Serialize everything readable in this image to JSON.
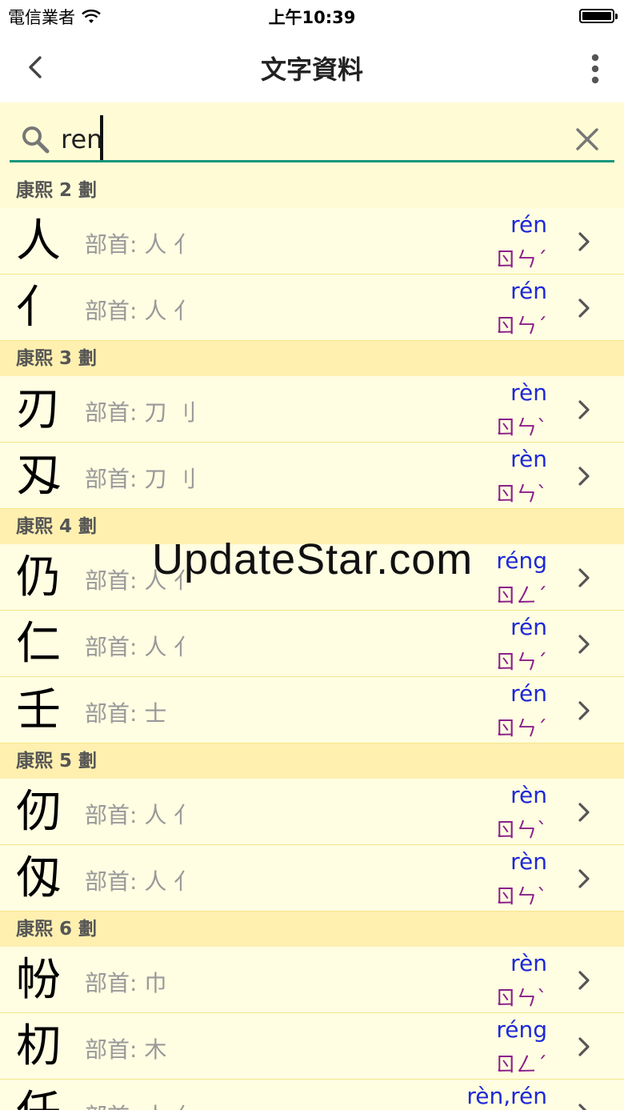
{
  "status_bar": {
    "carrier": "電信業者",
    "time": "上午10:39"
  },
  "nav": {
    "title": "文字資料"
  },
  "search": {
    "value": "ren"
  },
  "groups": [
    {
      "header": "康熙 2 劃",
      "rows": [
        {
          "char": "人",
          "radical": "部首: 人 亻",
          "pinyin": "rén",
          "zhuyin": "ㄖㄣˊ"
        },
        {
          "char": "亻",
          "radical": "部首: 人 亻",
          "pinyin": "rén",
          "zhuyin": "ㄖㄣˊ"
        }
      ]
    },
    {
      "header": "康熙 3 劃",
      "rows": [
        {
          "char": "刃",
          "radical": "部首: 刀 刂",
          "pinyin": "rèn",
          "zhuyin": "ㄖㄣˋ"
        },
        {
          "char": "刄",
          "radical": "部首: 刀 刂",
          "pinyin": "rèn",
          "zhuyin": "ㄖㄣˋ"
        }
      ]
    },
    {
      "header": "康熙 4 劃",
      "rows": [
        {
          "char": "仍",
          "radical": "部首: 人 亻",
          "pinyin": "réng",
          "zhuyin": "ㄖㄥˊ"
        },
        {
          "char": "仁",
          "radical": "部首: 人 亻",
          "pinyin": "rén",
          "zhuyin": "ㄖㄣˊ"
        },
        {
          "char": "壬",
          "radical": "部首: 士",
          "pinyin": "rén",
          "zhuyin": "ㄖㄣˊ"
        }
      ]
    },
    {
      "header": "康熙 5 劃",
      "rows": [
        {
          "char": "仞",
          "radical": "部首: 人 亻",
          "pinyin": "rèn",
          "zhuyin": "ㄖㄣˋ"
        },
        {
          "char": "仭",
          "radical": "部首: 人 亻",
          "pinyin": "rèn",
          "zhuyin": "ㄖㄣˋ"
        }
      ]
    },
    {
      "header": "康熙 6 劃",
      "rows": [
        {
          "char": "帉",
          "radical": "部首: 巾",
          "pinyin": "rèn",
          "zhuyin": "ㄖㄣˋ"
        },
        {
          "char": "朷",
          "radical": "部首: 木",
          "pinyin": "réng",
          "zhuyin": "ㄖㄥˊ"
        },
        {
          "char": "任",
          "radical": "部首: 人 亻",
          "pinyin": "rèn,rén",
          "zhuyin": ""
        }
      ]
    }
  ],
  "watermark": "UpdateStar.com",
  "colors": {
    "accent": "#14967c",
    "pinyin": "#1d28d8",
    "zhuyin": "#8a1f8a",
    "header_bg": "#fff0b0",
    "row_bg": "#fffde2"
  }
}
